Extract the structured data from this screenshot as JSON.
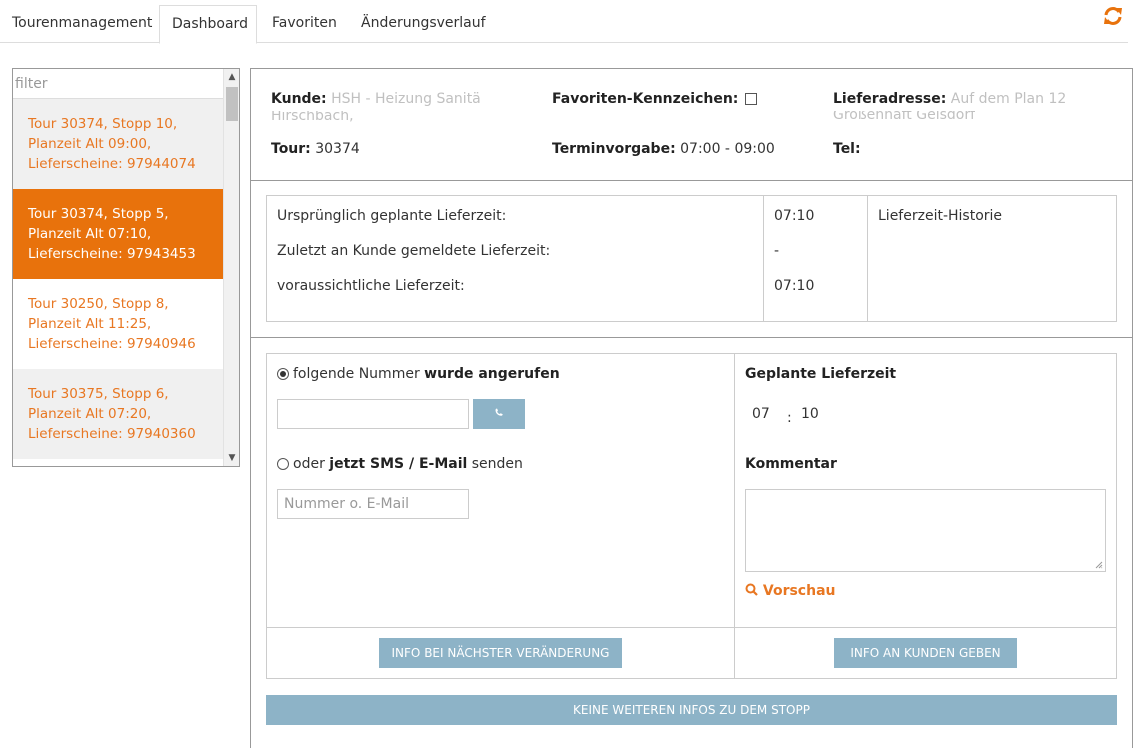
{
  "tabs": [
    {
      "label": "Tourenmanagement",
      "active": false
    },
    {
      "label": "Dashboard",
      "active": true
    },
    {
      "label": "Favoriten",
      "active": false
    },
    {
      "label": "Änderungsverlauf",
      "active": false
    }
  ],
  "refresh_icon": "refresh-icon",
  "accent_color": "#e8720c",
  "button_color": "#8db3c7",
  "filter": {
    "placeholder": "filter",
    "value": ""
  },
  "tour_list": [
    {
      "line1": "Tour 30374, Stopp 10,",
      "line2": "Planzeit Alt 09:00,",
      "line3": "Lieferscheine: 97944074",
      "selected": false
    },
    {
      "line1": "Tour 30374, Stopp 5,",
      "line2": "Planzeit Alt 07:10,",
      "line3": "Lieferscheine: 97943453",
      "selected": true
    },
    {
      "line1": "Tour 30250, Stopp 8,",
      "line2": "Planzeit Alt 11:25,",
      "line3": "Lieferscheine: 97940946",
      "selected": false
    },
    {
      "line1": "Tour 30375, Stopp 6,",
      "line2": "Planzeit Alt 07:20,",
      "line3": "Lieferscheine: 97940360",
      "selected": false
    }
  ],
  "header": {
    "kunde_label": "Kunde:",
    "kunde_value": "HSH - Heizung Sanitä",
    "kunde_line2": "Hirschbach,",
    "tour_label": "Tour:",
    "tour_value": "30374",
    "favoriten_label": "Favoriten-Kennzeichen:",
    "termin_label": "Terminvorgabe:",
    "termin_value": "07:00 - 09:00",
    "lieferadresse_label": "Lieferadresse:",
    "lieferadresse_value": "Auf dem Plan 12",
    "lieferadresse_line2": "Großenhaft Gelsdorf",
    "tel_label": "Tel:",
    "tel_value": ""
  },
  "lieferzeit": {
    "rows": [
      {
        "label": "Ursprünglich geplante Lieferzeit:",
        "value": "07:10"
      },
      {
        "label": "Zuletzt an Kunde gemeldete Lieferzeit:",
        "value": "-"
      },
      {
        "label": "voraussichtliche Lieferzeit:",
        "value": "07:10"
      }
    ],
    "history_label": "Lieferzeit-Historie"
  },
  "contact": {
    "called_prefix": "folgende Nummer ",
    "called_bold": "wurde angerufen",
    "phone_value": "",
    "phone_icon": "phone-icon",
    "sms_prefix": "oder ",
    "sms_bold": "jetzt SMS / E-Mail",
    "sms_suffix": " senden",
    "email_placeholder": "Nummer o. E-Mail"
  },
  "planned": {
    "title": "Geplante Lieferzeit",
    "hour": "07",
    "separator": ":",
    "minute": "10",
    "comment_label": "Kommentar",
    "comment_value": "",
    "preview_label": "Vorschau",
    "preview_icon": "search-icon"
  },
  "buttons": {
    "info_change": "INFO BEI NÄCHSTER VERÄNDERUNG",
    "info_customer": "INFO AN KUNDEN GEBEN",
    "no_more": "KEINE WEITEREN INFOS ZU DEM STOPP"
  }
}
